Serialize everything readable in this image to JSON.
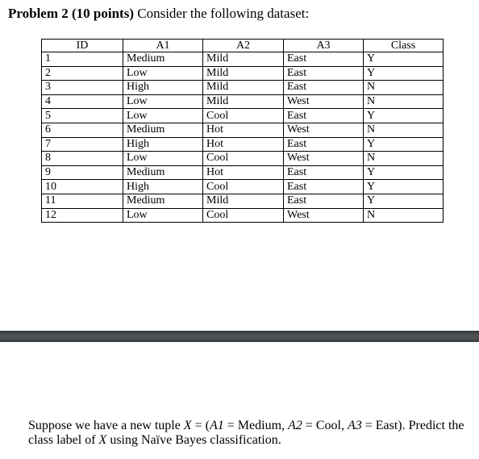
{
  "problem": {
    "label": "Problem 2 (10 points)",
    "intro": " Consider the following dataset:"
  },
  "table": {
    "headers": [
      "ID",
      "A1",
      "A2",
      "A3",
      "Class"
    ],
    "rows": [
      [
        "1",
        "Medium",
        "Mild",
        "East",
        "Y"
      ],
      [
        "2",
        "Low",
        "Mild",
        "East",
        "Y"
      ],
      [
        "3",
        "High",
        "Mild",
        "East",
        "N"
      ],
      [
        "4",
        "Low",
        "Mild",
        "West",
        "N"
      ],
      [
        "5",
        "Low",
        "Cool",
        "East",
        "Y"
      ],
      [
        "6",
        "Medium",
        "Hot",
        "West",
        "N"
      ],
      [
        "7",
        "High",
        "Hot",
        "East",
        "Y"
      ],
      [
        "8",
        "Low",
        "Cool",
        "West",
        "N"
      ],
      [
        "9",
        "Medium",
        "Hot",
        "East",
        "Y"
      ],
      [
        "10",
        "High",
        "Cool",
        "East",
        "Y"
      ],
      [
        "11",
        "Medium",
        "Mild",
        "East",
        "Y"
      ],
      [
        "12",
        "Low",
        "Cool",
        "West",
        "N"
      ]
    ]
  },
  "question": {
    "p1": "Suppose we have a new tuple ",
    "x": "X",
    "p2": " = (",
    "a1": "A1",
    "p3": " = Medium, ",
    "a2": "A2",
    "p4": " = Cool, ",
    "a3": "A3",
    "p5": " = East). Predict the class label of ",
    "x2": "X",
    "p6": " using Naïve Bayes classification."
  }
}
